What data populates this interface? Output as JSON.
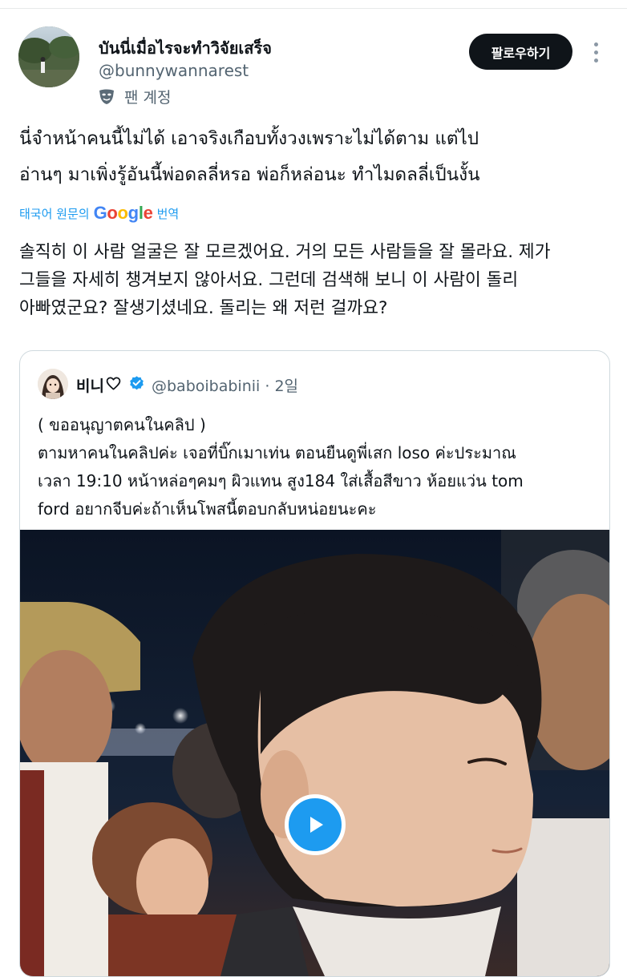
{
  "author": {
    "name": "บันนี่เมื่อไรจะทำวิจัยเสร็จ",
    "handle": "@bunnywannarest",
    "badge_label": "팬 계정",
    "badge_icon": "mask-icon"
  },
  "follow_button": {
    "label": "팔로우하기"
  },
  "more_button": {
    "icon": "more-vertical-icon"
  },
  "tweet": {
    "text": "นี่จำหน้าคนนี้ไม่ได้ เอาจริงเกือบทั้งวงเพราะไม่ได้ตาม แต่ไป\nอ่านๆ มาเพิ่งรู้อันนี้พ่อดลลี่หรอ พ่อก็หล่อนะ ทำไมดลลี่เป็นงั้น"
  },
  "translation": {
    "prefix": "태국어 원문의",
    "provider": "Google",
    "suffix": "번역",
    "text": "솔직히 이 사람 얼굴은 잘 모르겠어요. 거의 모든 사람들을 잘 몰라요. 제가\n그들을 자세히 챙겨보지 않아서요. 그런데 검색해 보니 이 사람이 돌리\n아빠였군요? 잘생기셨네요. 돌리는 왜 저런 걸까요?"
  },
  "quote": {
    "name": "비니",
    "handle": "@baboibabinii",
    "separator": "·",
    "time": "2일",
    "heart_icon": "heart-icon",
    "verified_icon": "verified-badge-icon",
    "text": "( ขออนุญาตคนในคลิป )\nตามหาคนในคลิปค่ะ เจอที่บิ๊กเมาเท่น ตอนยืนดูพี่เสก loso ค่ะประมาณ\nเวลา 19:10 หน้าหล่อๆคมๆ ผิวแทน สูง184 ใส่เสื้อสีขาว ห้อยแว่น tom\nford อยากจีบค่ะถ้าเห็นโพสนี้ตอบกลับหน่อยนะคะ",
    "video": {
      "play_icon": "play-icon"
    }
  },
  "colors": {
    "accent": "#1d9bf0",
    "text": "#0f1419",
    "secondary_text": "#536471",
    "border": "#cfd9de",
    "follow_bg": "#0f1419"
  }
}
